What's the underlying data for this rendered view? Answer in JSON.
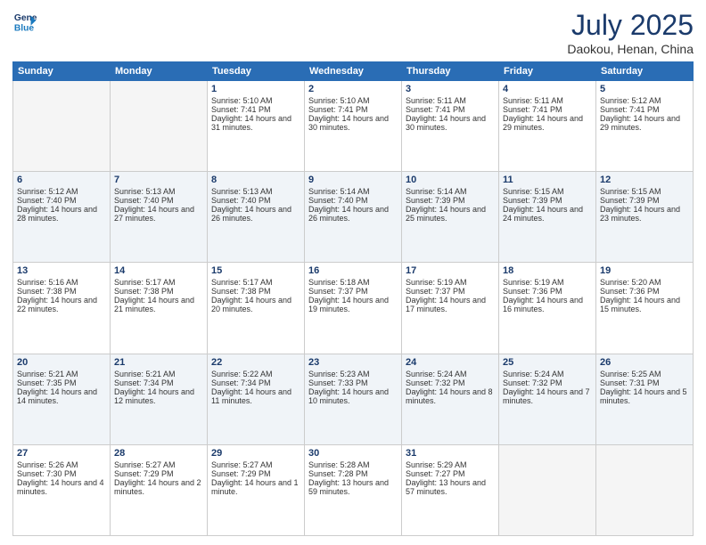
{
  "logo": {
    "line1": "General",
    "line2": "Blue"
  },
  "title": "July 2025",
  "subtitle": "Daokou, Henan, China",
  "headers": [
    "Sunday",
    "Monday",
    "Tuesday",
    "Wednesday",
    "Thursday",
    "Friday",
    "Saturday"
  ],
  "weeks": [
    [
      {
        "day": "",
        "empty": true
      },
      {
        "day": "",
        "empty": true
      },
      {
        "day": "1",
        "sunrise": "Sunrise: 5:10 AM",
        "sunset": "Sunset: 7:41 PM",
        "daylight": "Daylight: 14 hours and 31 minutes."
      },
      {
        "day": "2",
        "sunrise": "Sunrise: 5:10 AM",
        "sunset": "Sunset: 7:41 PM",
        "daylight": "Daylight: 14 hours and 30 minutes."
      },
      {
        "day": "3",
        "sunrise": "Sunrise: 5:11 AM",
        "sunset": "Sunset: 7:41 PM",
        "daylight": "Daylight: 14 hours and 30 minutes."
      },
      {
        "day": "4",
        "sunrise": "Sunrise: 5:11 AM",
        "sunset": "Sunset: 7:41 PM",
        "daylight": "Daylight: 14 hours and 29 minutes."
      },
      {
        "day": "5",
        "sunrise": "Sunrise: 5:12 AM",
        "sunset": "Sunset: 7:41 PM",
        "daylight": "Daylight: 14 hours and 29 minutes."
      }
    ],
    [
      {
        "day": "6",
        "sunrise": "Sunrise: 5:12 AM",
        "sunset": "Sunset: 7:40 PM",
        "daylight": "Daylight: 14 hours and 28 minutes."
      },
      {
        "day": "7",
        "sunrise": "Sunrise: 5:13 AM",
        "sunset": "Sunset: 7:40 PM",
        "daylight": "Daylight: 14 hours and 27 minutes."
      },
      {
        "day": "8",
        "sunrise": "Sunrise: 5:13 AM",
        "sunset": "Sunset: 7:40 PM",
        "daylight": "Daylight: 14 hours and 26 minutes."
      },
      {
        "day": "9",
        "sunrise": "Sunrise: 5:14 AM",
        "sunset": "Sunset: 7:40 PM",
        "daylight": "Daylight: 14 hours and 26 minutes."
      },
      {
        "day": "10",
        "sunrise": "Sunrise: 5:14 AM",
        "sunset": "Sunset: 7:39 PM",
        "daylight": "Daylight: 14 hours and 25 minutes."
      },
      {
        "day": "11",
        "sunrise": "Sunrise: 5:15 AM",
        "sunset": "Sunset: 7:39 PM",
        "daylight": "Daylight: 14 hours and 24 minutes."
      },
      {
        "day": "12",
        "sunrise": "Sunrise: 5:15 AM",
        "sunset": "Sunset: 7:39 PM",
        "daylight": "Daylight: 14 hours and 23 minutes."
      }
    ],
    [
      {
        "day": "13",
        "sunrise": "Sunrise: 5:16 AM",
        "sunset": "Sunset: 7:38 PM",
        "daylight": "Daylight: 14 hours and 22 minutes."
      },
      {
        "day": "14",
        "sunrise": "Sunrise: 5:17 AM",
        "sunset": "Sunset: 7:38 PM",
        "daylight": "Daylight: 14 hours and 21 minutes."
      },
      {
        "day": "15",
        "sunrise": "Sunrise: 5:17 AM",
        "sunset": "Sunset: 7:38 PM",
        "daylight": "Daylight: 14 hours and 20 minutes."
      },
      {
        "day": "16",
        "sunrise": "Sunrise: 5:18 AM",
        "sunset": "Sunset: 7:37 PM",
        "daylight": "Daylight: 14 hours and 19 minutes."
      },
      {
        "day": "17",
        "sunrise": "Sunrise: 5:19 AM",
        "sunset": "Sunset: 7:37 PM",
        "daylight": "Daylight: 14 hours and 17 minutes."
      },
      {
        "day": "18",
        "sunrise": "Sunrise: 5:19 AM",
        "sunset": "Sunset: 7:36 PM",
        "daylight": "Daylight: 14 hours and 16 minutes."
      },
      {
        "day": "19",
        "sunrise": "Sunrise: 5:20 AM",
        "sunset": "Sunset: 7:36 PM",
        "daylight": "Daylight: 14 hours and 15 minutes."
      }
    ],
    [
      {
        "day": "20",
        "sunrise": "Sunrise: 5:21 AM",
        "sunset": "Sunset: 7:35 PM",
        "daylight": "Daylight: 14 hours and 14 minutes."
      },
      {
        "day": "21",
        "sunrise": "Sunrise: 5:21 AM",
        "sunset": "Sunset: 7:34 PM",
        "daylight": "Daylight: 14 hours and 12 minutes."
      },
      {
        "day": "22",
        "sunrise": "Sunrise: 5:22 AM",
        "sunset": "Sunset: 7:34 PM",
        "daylight": "Daylight: 14 hours and 11 minutes."
      },
      {
        "day": "23",
        "sunrise": "Sunrise: 5:23 AM",
        "sunset": "Sunset: 7:33 PM",
        "daylight": "Daylight: 14 hours and 10 minutes."
      },
      {
        "day": "24",
        "sunrise": "Sunrise: 5:24 AM",
        "sunset": "Sunset: 7:32 PM",
        "daylight": "Daylight: 14 hours and 8 minutes."
      },
      {
        "day": "25",
        "sunrise": "Sunrise: 5:24 AM",
        "sunset": "Sunset: 7:32 PM",
        "daylight": "Daylight: 14 hours and 7 minutes."
      },
      {
        "day": "26",
        "sunrise": "Sunrise: 5:25 AM",
        "sunset": "Sunset: 7:31 PM",
        "daylight": "Daylight: 14 hours and 5 minutes."
      }
    ],
    [
      {
        "day": "27",
        "sunrise": "Sunrise: 5:26 AM",
        "sunset": "Sunset: 7:30 PM",
        "daylight": "Daylight: 14 hours and 4 minutes."
      },
      {
        "day": "28",
        "sunrise": "Sunrise: 5:27 AM",
        "sunset": "Sunset: 7:29 PM",
        "daylight": "Daylight: 14 hours and 2 minutes."
      },
      {
        "day": "29",
        "sunrise": "Sunrise: 5:27 AM",
        "sunset": "Sunset: 7:29 PM",
        "daylight": "Daylight: 14 hours and 1 minute."
      },
      {
        "day": "30",
        "sunrise": "Sunrise: 5:28 AM",
        "sunset": "Sunset: 7:28 PM",
        "daylight": "Daylight: 13 hours and 59 minutes."
      },
      {
        "day": "31",
        "sunrise": "Sunrise: 5:29 AM",
        "sunset": "Sunset: 7:27 PM",
        "daylight": "Daylight: 13 hours and 57 minutes."
      },
      {
        "day": "",
        "empty": true
      },
      {
        "day": "",
        "empty": true
      }
    ]
  ]
}
